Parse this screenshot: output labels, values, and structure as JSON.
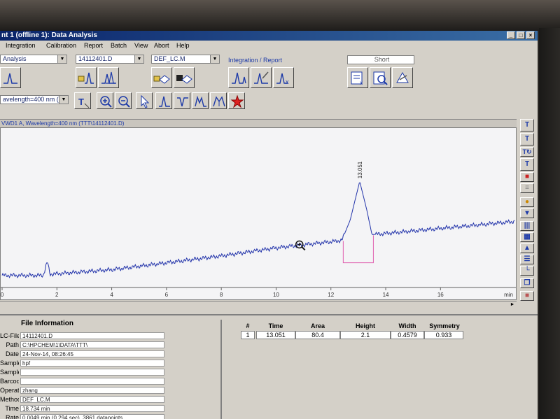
{
  "window": {
    "title": "nt 1 (offline 1): Data Analysis"
  },
  "menu": [
    "Integration",
    "Calibration",
    "Report",
    "Batch",
    "View",
    "Abort",
    "Help"
  ],
  "toolbar": {
    "view_select": "Analysis",
    "datafile_select": "14112401.D",
    "method_select": "DEF_LC.M",
    "integration_group_label": "Integration / Report",
    "report_style_select": "Short"
  },
  "signal_toolbar": {
    "signal_select": "avelength=400 nm (T"
  },
  "signal_header": "VWD1 A, Wavelength=400 nm (TTT\\14112401.D)",
  "chart_data": {
    "type": "line",
    "x_ticks": [
      "0",
      "2",
      "4",
      "6",
      "8",
      "10",
      "12",
      "14",
      "16"
    ],
    "x_unit": "min",
    "xlim": [
      0,
      18.7
    ],
    "peak_label": "13.051",
    "series": [
      {
        "values": [
          [
            0,
            0.2
          ],
          [
            1.5,
            0.2
          ],
          [
            1.65,
            1.4
          ],
          [
            1.75,
            0.3
          ],
          [
            4,
            0.7
          ],
          [
            6,
            1.3
          ],
          [
            8,
            1.9
          ],
          [
            10,
            2.6
          ],
          [
            11.5,
            3.0
          ],
          [
            12.4,
            3.25
          ],
          [
            12.7,
            5.0
          ],
          [
            13.051,
            8.4
          ],
          [
            13.3,
            6.0
          ],
          [
            13.5,
            3.75
          ],
          [
            16,
            4.3
          ],
          [
            18.7,
            4.9
          ]
        ]
      }
    ],
    "baseline": {
      "from": [
        12.45,
        2.4
      ],
      "to": [
        13.55,
        2.4
      ]
    }
  },
  "file_info": {
    "title": "File Information",
    "rows": [
      {
        "key": "LC-File",
        "value": "14112401.D"
      },
      {
        "key": "Path",
        "value": "C:\\HPCHEM\\1\\DATA\\TTT\\"
      },
      {
        "key": "Date",
        "value": "24-Nov-14, 08:26:45"
      },
      {
        "key": "Sample",
        "value": "hpf"
      },
      {
        "key": "Sample Info",
        "value": ""
      },
      {
        "key": "Barcode",
        "value": ""
      },
      {
        "key": "Operator",
        "value": "zhang"
      },
      {
        "key": "Method",
        "value": "DEF_LC.M"
      },
      {
        "key": "Time",
        "value": "18.734 min"
      },
      {
        "key": "Rate",
        "value": "0.0049 min (0.294 sec), 3861 datapoints"
      }
    ]
  },
  "peak_table": {
    "headers": [
      "#",
      "Time",
      "Area",
      "Height",
      "Width",
      "Symmetry"
    ],
    "rows": [
      [
        "1",
        "13.051",
        "80.4",
        "2.1",
        "0.4579",
        "0.933"
      ]
    ]
  },
  "colors": {
    "trace": "#2233aa",
    "integration_baseline": "#e060b0",
    "title_bar": "#0a246a"
  },
  "icons": [
    "load-signal-icon",
    "zoom-in-icon",
    "zoom-out-icon",
    "select-arrow-icon",
    "integrate-icon",
    "report-icon"
  ]
}
